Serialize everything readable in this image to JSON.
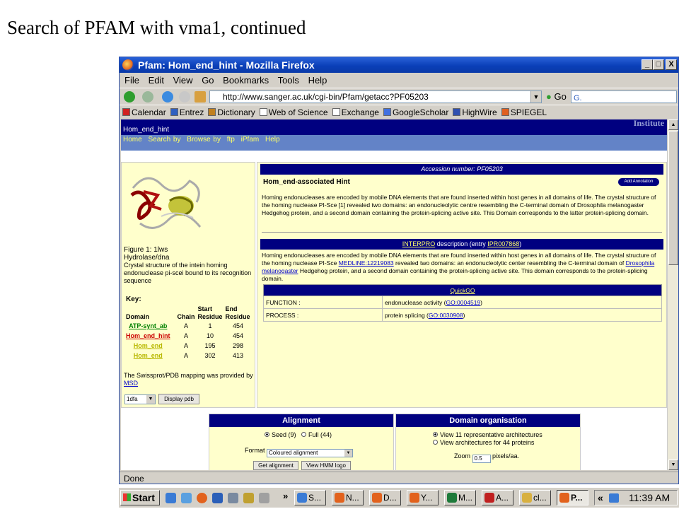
{
  "slide": {
    "title": "Search of PFAM with vma1, continued"
  },
  "window": {
    "title": "Pfam: Hom_end_hint - Mozilla Firefox",
    "controls": {
      "minimize": "_",
      "maximize": "□",
      "close": "X"
    }
  },
  "menu": {
    "file": "File",
    "edit": "Edit",
    "view": "View",
    "go": "Go",
    "bookmarks": "Bookmarks",
    "tools": "Tools",
    "help": "Help"
  },
  "navbar": {
    "url": "http://www.sanger.ac.uk/cgi-bin/Pfam/getacc?PF05203",
    "go_label": "Go",
    "search_value": "G."
  },
  "bookmarks": [
    {
      "label": "Calendar",
      "icon": "calendar-icon",
      "color": "#d02020"
    },
    {
      "label": "Entrez",
      "icon": "entrez-icon",
      "color": "#3060c0"
    },
    {
      "label": "Dictionary",
      "icon": "dictionary-icon",
      "color": "#c08020"
    },
    {
      "label": "Web of Science",
      "icon": "page-icon",
      "color": "#ffffff"
    },
    {
      "label": "Exchange",
      "icon": "page-icon",
      "color": "#ffffff"
    },
    {
      "label": "GoogleScholar",
      "icon": "google-icon",
      "color": "#4070e0"
    },
    {
      "label": "HighWire",
      "icon": "highwire-icon",
      "color": "#3050b0"
    },
    {
      "label": "SPIEGEL",
      "icon": "spiegel-icon",
      "color": "#e06020"
    }
  ],
  "pfam": {
    "family": "Hom_end_hint",
    "institute": "Institute",
    "nav": {
      "home": "Home",
      "search_by": "Search by",
      "browse_by": "Browse by",
      "ftp": "ftp",
      "ipfam": "iPfam",
      "help": "Help"
    },
    "figure": {
      "caption_title": "Figure 1: 1lws",
      "caption_type": "Hydrolase/dna",
      "caption_text": "Crystal structure of the intein homing endonuclease pi-scei bound to its recognition sequence"
    },
    "key": {
      "label": "Key:",
      "headers": {
        "domain": "Domain",
        "chain": "Chain",
        "start": "Start Residue",
        "end": "End Residue"
      },
      "rows": [
        {
          "domain": "ATP-synt_ab",
          "chain": "A",
          "start": "1",
          "end": "454",
          "color": "#008000"
        },
        {
          "domain": "Hom_end_hint",
          "chain": "A",
          "start": "10",
          "end": "454",
          "color": "#cc0000"
        },
        {
          "domain": "Hom_end",
          "chain": "A",
          "start": "195",
          "end": "298",
          "color": "#b8b800"
        },
        {
          "domain": "Hom_end",
          "chain": "A",
          "start": "302",
          "end": "413",
          "color": "#b8b800"
        }
      ]
    },
    "mapping_note": "The Swissprot/PDB mapping was provided by",
    "mapping_link": "MSD",
    "pdb_select": "1dfa",
    "display_pdb": "Display pdb",
    "accession": "Accession number: PF05203",
    "hint_title": "Hom_end-associated Hint",
    "add_annotation": "Add Annotation",
    "description": "Homing endonucleases are encoded by mobile DNA elements that are found inserted within host genes in all domains of life. The crystal structure of the homing nuclease PI-Sce [1] revealed two domains: an endonucleolytic centre resembling the C-terminal domain of Drosophila melanogaster Hedgehog protein, and a second domain containing the protein-splicing active site. This Domain corresponds to the latter protein-splicing domain.",
    "interpro": {
      "link": "INTERPRO",
      "text_mid": " description (entry ",
      "entry": "IPR007868",
      "text_end": ")"
    },
    "interpro_desc": {
      "part1": "Homing endonucleases are encoded by mobile DNA elements that are found inserted within host genes in all domains of life. The crystal structure of the homing nuclease PI-Sce ",
      "medline": "MEDLINE:12219083",
      "part2": " revealed two domains: an endonucleolytic center resembling the C-terminal domain of ",
      "species": "Drosophila melanogaster",
      "part3": " Hedgehog protein, and a second domain containing the protein-splicing active site. This domain corresponds to the protein-splicing domain."
    },
    "quickgo": {
      "header": "QuickGO",
      "rows": [
        {
          "label": "FUNCTION :",
          "value_pre": "endonuclease activity (",
          "go_id": "GO:0004519",
          "value_post": ")"
        },
        {
          "label": "PROCESS :",
          "value_pre": "protein splicing (",
          "go_id": "GO:0030908",
          "value_post": ")"
        }
      ]
    },
    "alignment": {
      "title": "Alignment",
      "seed": "Seed (9)",
      "full": "Full (44)",
      "format_label": "Format",
      "format_value": "Coloured alignment",
      "get_alignment": "Get alignment",
      "view_hmm": "View HMM logo"
    },
    "domain_org": {
      "title": "Domain organisation",
      "opt1": "View 11 representative architectures",
      "opt2": "View architectures for 44 proteins",
      "zoom_label": "Zoom",
      "zoom_value": "0.5",
      "zoom_unit": "pixels/aa."
    }
  },
  "status": "Done",
  "taskbar": {
    "start": "Start",
    "quick_launch_chevron": "»",
    "tasks": [
      {
        "label": "S...",
        "icon": "search-icon",
        "color": "#3a7bd5"
      },
      {
        "label": "N...",
        "icon": "firefox-icon",
        "color": "#e2621d"
      },
      {
        "label": "D...",
        "icon": "firefox-icon",
        "color": "#e2621d"
      },
      {
        "label": "Y...",
        "icon": "firefox-icon",
        "color": "#e2621d"
      },
      {
        "label": "M...",
        "icon": "excel-icon",
        "color": "#1e7a3a"
      },
      {
        "label": "A...",
        "icon": "acrobat-icon",
        "color": "#c02020"
      },
      {
        "label": "cl...",
        "icon": "folder-icon",
        "color": "#d8b040"
      },
      {
        "label": "P...",
        "icon": "firefox-icon",
        "color": "#e2621d"
      }
    ],
    "tray_chevron": "«",
    "clock": "11:39 AM"
  }
}
